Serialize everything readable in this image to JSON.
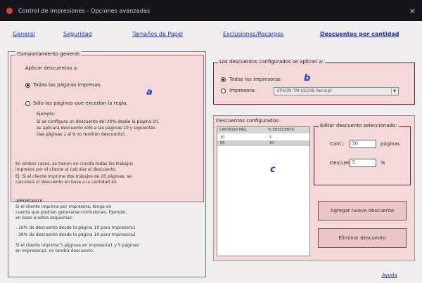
{
  "window": {
    "title": "Control de impresiones - Opciones avanzadas",
    "close": "×"
  },
  "tabs": [
    {
      "label": "General"
    },
    {
      "label": "Seguridad"
    },
    {
      "label": "Tamaños de Papel"
    },
    {
      "label": "Exclusiones/Recargos"
    },
    {
      "label": "Descuentos por cantidad"
    }
  ],
  "behavior": {
    "legend": "Comportamiento general:",
    "apply_label": "Aplicar descuentos a:",
    "option_all": "Todas las páginas impresas.",
    "option_exceed": "Sólo las páginas que excedan la regla.",
    "example_title": "Ejemplo:",
    "example_line1": "Si se configura un descuento del 20% desde la página 10,",
    "example_line2": "se aplicará descuento sólo a las páginas 10 y siguientes",
    "example_line3": "(las páginas 1 al 9 no tendrán descuento).",
    "marker": "a"
  },
  "notes": {
    "p1_l1": "En ambos casos, se tienen en cuenta todas las trabajos",
    "p1_l2": "impresos por el cliente al calcular el descuento.",
    "p2_l1": "Ej: Si el cliente imprime dos trabajos de 20 páginas, se",
    "p2_l2": "calculará el descuento en base a la cantidad 40.",
    "important": "IMPORTANTE:",
    "p3_l1": "Si el cliente imprime por impresora, tenga en",
    "p3_l2": "cuenta que podrían generarse confusiones. Ejemplo,",
    "p3_l3": "en base a estos esquemas:",
    "p4_l1": "- 10% de descuento desde la página 10 para Impresora1",
    "p4_l2": "- 20% de descuento desde la página 10 para Impresora2",
    "p5_l1": "Si el cliente imprime 5 páginas en Impresora1 y 5 páginas",
    "p5_l2": "en Impresora2, no tendrá descuento."
  },
  "applied": {
    "legend": "Los descuentos configurados se aplican a:",
    "option_all": "Todas las impresoras",
    "option_printer": "Impresora:",
    "printer_value": "EPSON TM-U220B Receipt",
    "marker": "b"
  },
  "configured": {
    "legend": "Descuentos configurados:",
    "col_qty": "CANTIDAD PÁG.",
    "col_pct": "% DESCUENTO",
    "rows": [
      {
        "qty": "10",
        "pct": "5",
        "selected": false
      },
      {
        "qty": "50",
        "pct": "10",
        "selected": true
      }
    ],
    "marker": "c"
  },
  "edit": {
    "legend": "Editar descuento seleccionado:",
    "qty_label": "Cant.:",
    "qty_value": "50",
    "qty_unit": "páginas",
    "discount_label": "Descuento:",
    "discount_value": "5",
    "discount_unit": "%"
  },
  "buttons": {
    "add": "Agregar nuevo descuento",
    "remove": "Eliminar descuento"
  },
  "help": "Ayuda",
  "colors": {
    "panel_pink": "#f4d8da",
    "title_bar": "#15151b",
    "link_blue": "#2331a8",
    "marker_blue": "#2b3bd6"
  }
}
